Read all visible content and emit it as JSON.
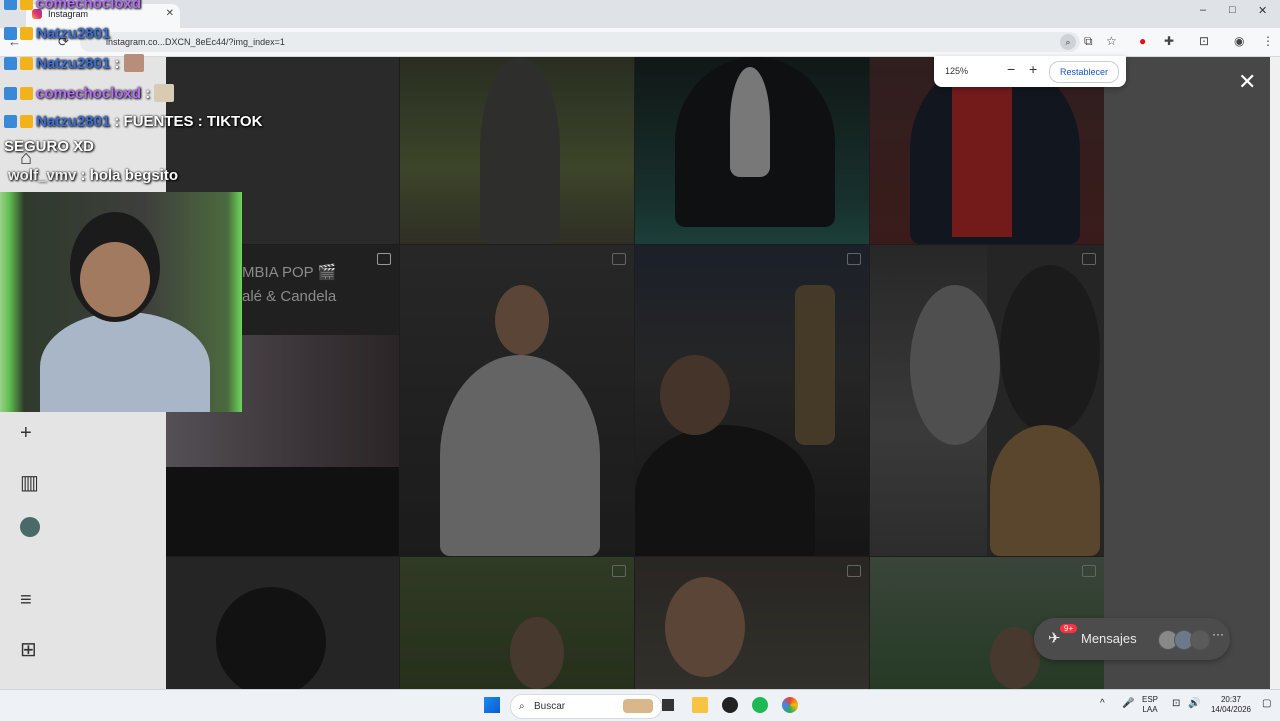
{
  "browser": {
    "tab_title": "Instagram",
    "url": "instagram.co...DXCN_8eEc44/?img_index=1",
    "min": "–",
    "max": "□",
    "close": "✕"
  },
  "zoom": {
    "level": "125%",
    "minus": "−",
    "plus": "+",
    "reset": "Restablecer"
  },
  "viewer": {
    "close": "✕"
  },
  "grid": {
    "cumbia_text": [
      "MBIA POP 🎬",
      "alé & Candela"
    ]
  },
  "messages": {
    "label": "Mensajes",
    "badge": "9+",
    "more": "···"
  },
  "chat": [
    {
      "user": "comechocloxd",
      "text": ""
    },
    {
      "user": "Natzu2801",
      "text": ""
    },
    {
      "user": "Natzu2801",
      "text": ":"
    },
    {
      "user": "comechocloxd",
      "text": ":"
    },
    {
      "user": "Natzu2801",
      "text": ": FUENTES : TIKTOK"
    },
    {
      "user": "",
      "text": "SEGURO XD"
    },
    {
      "user": "wolf_vmv",
      "text": ": hola begsito"
    }
  ],
  "taskbar": {
    "search_placeholder": "Buscar",
    "lang_top": "ESP",
    "lang_bottom": "LAA",
    "time": "20:37",
    "date": "14/04/2026"
  },
  "colors": {
    "accent_link": "#1a56c8",
    "badge": "#ff3040",
    "chat_user_blue": "#3b6fd8",
    "chat_user_purple": "#b46ef7"
  }
}
